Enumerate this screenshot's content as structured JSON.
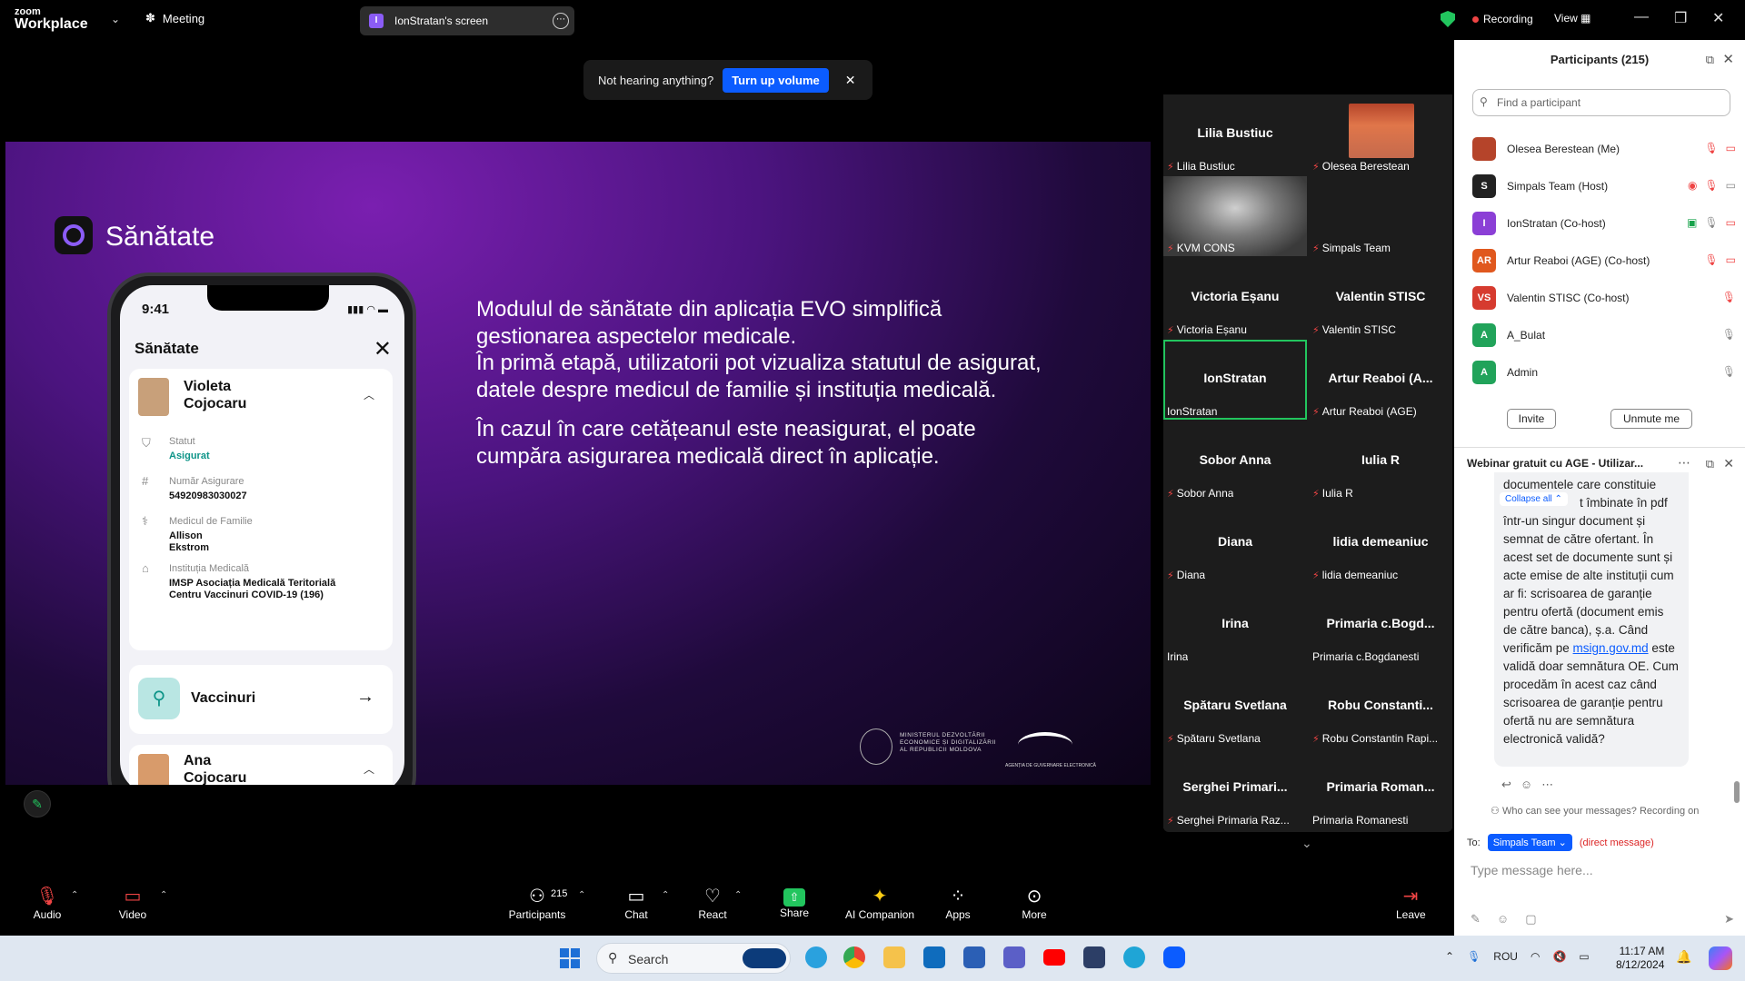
{
  "topbar": {
    "logo_line1": "zoom",
    "logo_line2": "Workplace",
    "meeting_label": "Meeting",
    "screen_tab": "IonStratan's screen",
    "screen_tab_avatar": "I",
    "recording": "Recording",
    "view": "View"
  },
  "toast": {
    "message": "Not hearing anything?",
    "button": "Turn up volume"
  },
  "slide": {
    "app_title": "Sănătate",
    "paragraph1": "Modulul de sănătate din aplicația EVO simplifică gestionarea aspectelor medicale.",
    "paragraph2": "În primă etapă, utilizatorii pot vizualiza statutul de asigurat, datele despre medicul de familie și instituția medicală.",
    "paragraph3": "În cazul în care cetățeanul este neasigurat, el poate cumpăra asigurarea medicală direct în aplicație.",
    "ministry_line1": "MINISTERUL DEZVOLTĂRII",
    "ministry_line2": "ECONOMICE ȘI DIGITALIZĂRII",
    "ministry_line3": "AL REPUBLICII MOLDOVA",
    "agency": "AGENȚIA DE GUVERNARE ELECTRONICĂ",
    "phone": {
      "time": "9:41",
      "title": "Sănătate",
      "person1_name1": "Violeta",
      "person1_name2": "Cojocaru",
      "status_label": "Statut",
      "status_value": "Asigurat",
      "insurance_label": "Număr Asigurare",
      "insurance_value": "54920983030027",
      "doctor_label": "Medicul de Familie",
      "doctor_value1": "Allison",
      "doctor_value2": "Ekstrom",
      "institution_label": "Instituția Medicală",
      "institution_value1": "IMSP Asociația Medicală Teritorială",
      "institution_value2": "Centru Vaccinuri COVID-19 (196)",
      "vaccines": "Vaccinuri",
      "person2_name1": "Ana",
      "person2_name2": "Cojocaru"
    }
  },
  "gallery": [
    {
      "name": "Lilia Bustiuc",
      "label": "Lilia Bustiuc",
      "muted": true
    },
    {
      "name": "",
      "label": "Olesea Berestean",
      "muted": true
    },
    {
      "name": "",
      "label": "KVM CONS",
      "muted": true
    },
    {
      "name": "",
      "label": "Simpals Team",
      "muted": true
    },
    {
      "name": "Victoria Eșanu",
      "label": "Victoria Eșanu",
      "muted": true
    },
    {
      "name": "Valentin STISC",
      "label": "Valentin STISC",
      "muted": true
    },
    {
      "name": "IonStratan",
      "label": "IonStratan",
      "muted": false
    },
    {
      "name": "Artur Reaboi (A...",
      "label": "Artur Reaboi (AGE)",
      "muted": true
    },
    {
      "name": "Sobor Anna",
      "label": "Sobor Anna",
      "muted": true
    },
    {
      "name": "Iulia R",
      "label": "Iulia R",
      "muted": true
    },
    {
      "name": "Diana",
      "label": "Diana",
      "muted": true
    },
    {
      "name": "lidia demeaniuc",
      "label": "lidia demeaniuc",
      "muted": true
    },
    {
      "name": "Irina",
      "label": "Irina",
      "muted": false
    },
    {
      "name": "Primaria  c.Bogd...",
      "label": "Primaria c.Bogdanesti",
      "muted": false
    },
    {
      "name": "Spătaru Svetlana",
      "label": "Spătaru Svetlana",
      "muted": true
    },
    {
      "name": "Robu  Constanti...",
      "label": "Robu Constantin Rapi...",
      "muted": true
    },
    {
      "name": "Serghei  Primari...",
      "label": "Serghei Primaria Raz...",
      "muted": true
    },
    {
      "name": "Primaria  Roman...",
      "label": "Primaria Romanesti",
      "muted": false
    }
  ],
  "participants": {
    "title": "Participants (215)",
    "search_placeholder": "Find a participant",
    "list": [
      {
        "initials": "",
        "name": "Olesea Berestean (Me)",
        "color": "#b5442a"
      },
      {
        "initials": "S",
        "name": "Simpals Team (Host)",
        "color": "#222222"
      },
      {
        "initials": "I",
        "name": "IonStratan (Co-host)",
        "color": "#8b3fd6"
      },
      {
        "initials": "AR",
        "name": "Artur Reaboi (AGE) (Co-host)",
        "color": "#e0581e"
      },
      {
        "initials": "VS",
        "name": "Valentin STISC (Co-host)",
        "color": "#d63b2f"
      },
      {
        "initials": "A",
        "name": "A_Bulat",
        "color": "#21a35a"
      },
      {
        "initials": "A",
        "name": "Admin",
        "color": "#21a35a"
      }
    ],
    "invite": "Invite",
    "unmute": "Unmute me"
  },
  "chat": {
    "title": "Webinar gratuit cu AGE - Utilizar...",
    "collapse": "Collapse all",
    "msg_top": "documentele care constituie",
    "msg_part1": "t îmbinate în pdf într-un singur document și semnat de către ofertant. În acest set de documente sunt și acte emise de alte instituții cum ar fi: scrisoarea de garanție pentru ofertă (document emis de către banca), ș.a. Când verificăm pe",
    "msg_link": "msign.gov.md",
    "msg_part2": "este validă doar semnătura OE. Cum procedăm în acest caz când scrisoarea de garanție pentru ofertă nu are semnătura electronică validă?",
    "info": "Who can see your messages? Recording on",
    "to_label": "To:",
    "recipient": "Simpals Team",
    "dm": "(direct message)",
    "input_placeholder": "Type message here..."
  },
  "toolbar": {
    "audio": "Audio",
    "video": "Video",
    "participants": "Participants",
    "participants_count": "215",
    "chat": "Chat",
    "react": "React",
    "share": "Share",
    "ai": "AI Companion",
    "apps": "Apps",
    "more": "More",
    "leave": "Leave"
  },
  "taskbar": {
    "search": "Search",
    "lang": "ROU",
    "time": "11:17 AM",
    "date": "8/12/2024"
  }
}
